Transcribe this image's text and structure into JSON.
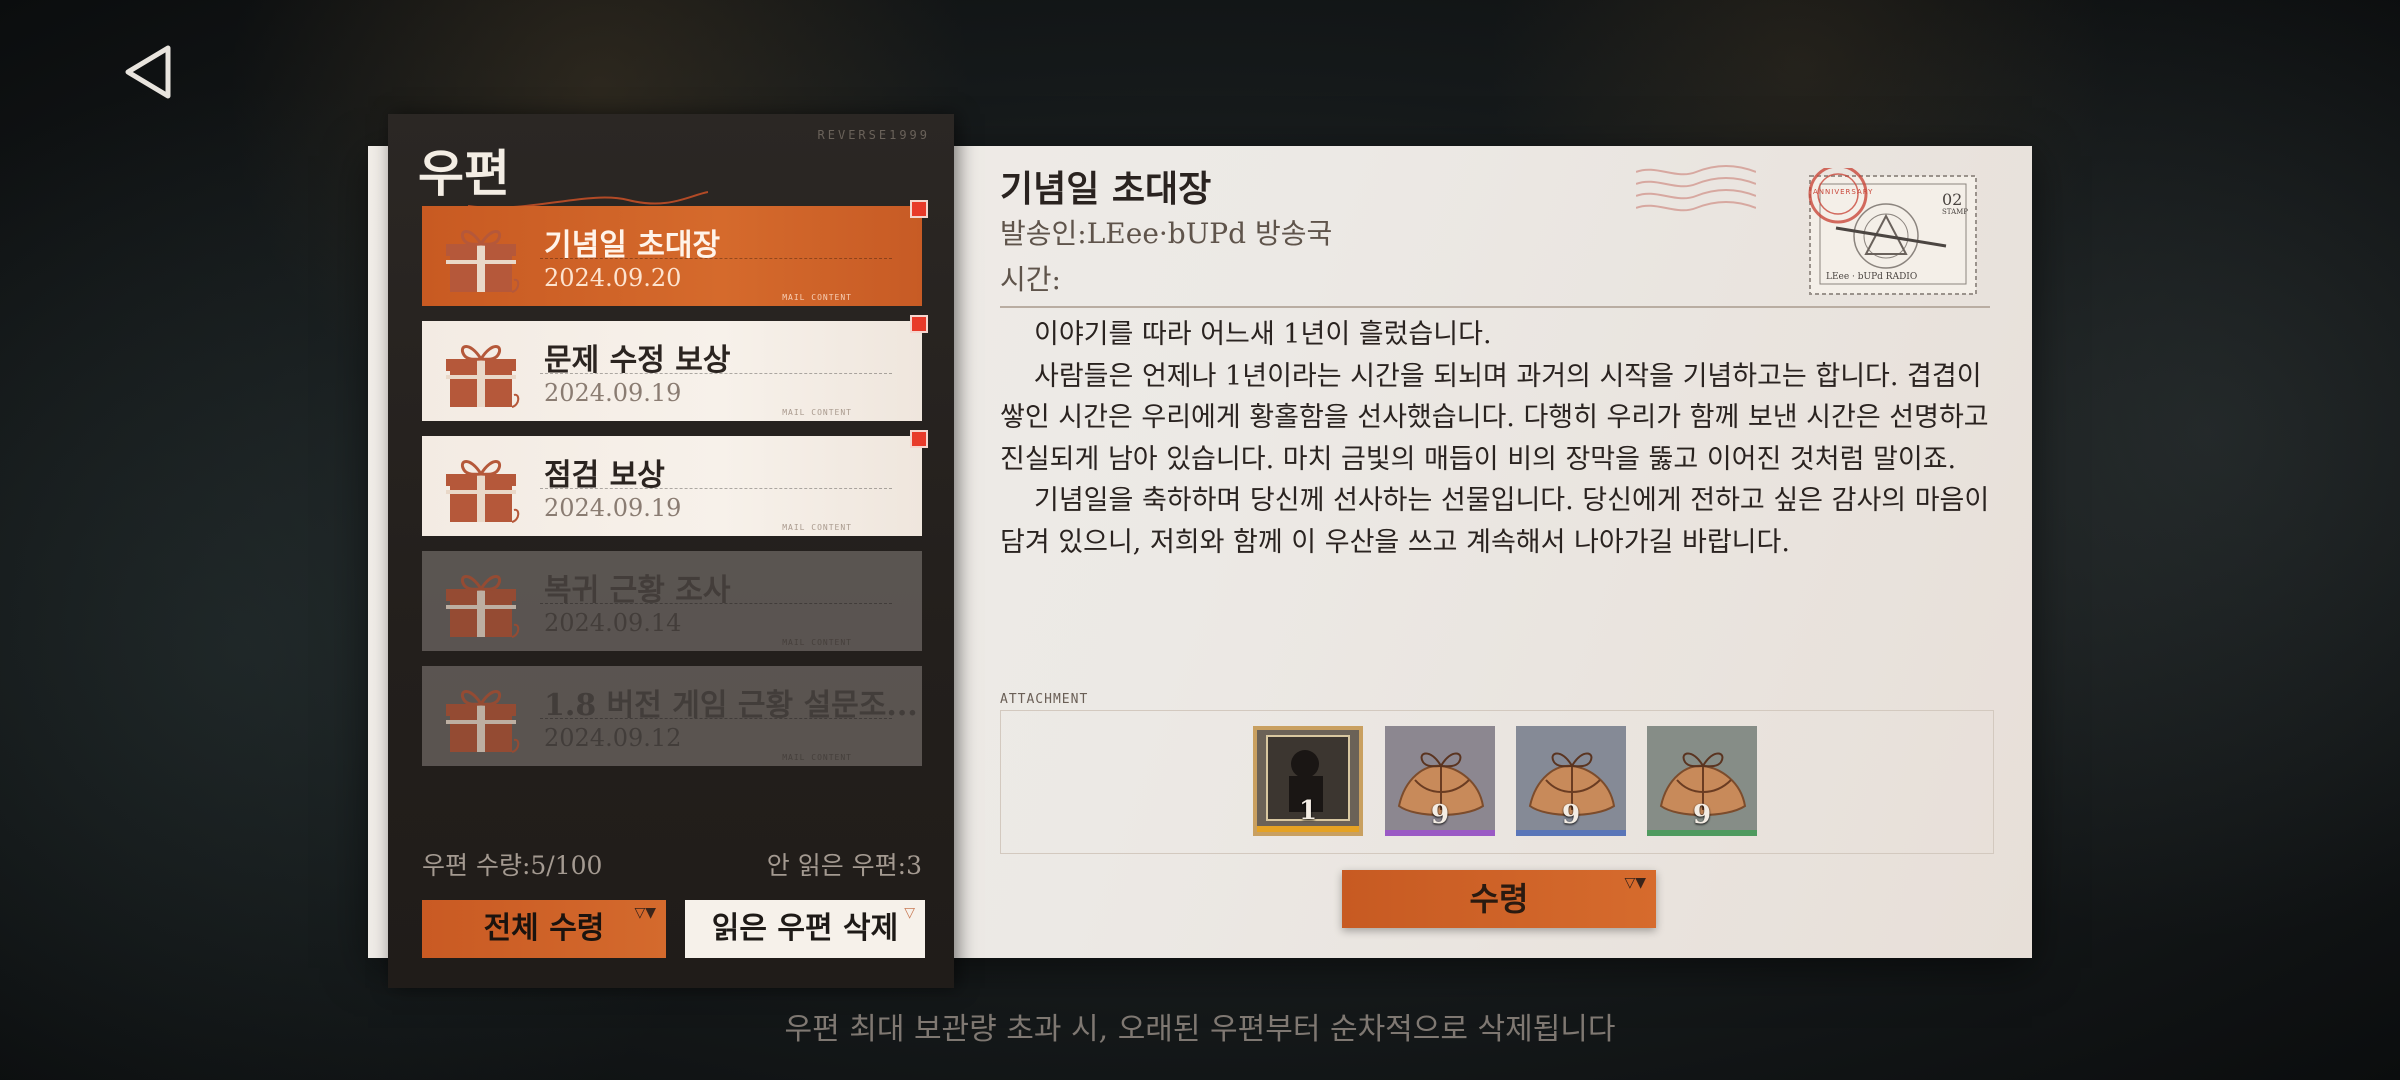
{
  "header": {
    "back_icon": "back-triangle-icon"
  },
  "panel": {
    "title": "우편",
    "brand": "REVERSE1999",
    "stats": {
      "count_label": "우편 수량:5/100",
      "unread_label": "안 읽은 우편:3"
    },
    "claim_all_label": "전체 수령",
    "delete_read_label": "읽은 우편 삭제"
  },
  "mails": [
    {
      "title": "기념일 초대장",
      "date": "2024.09.20",
      "state": "selected",
      "tag": "MAIL CONTENT",
      "new": true
    },
    {
      "title": "문제 수정 보상",
      "date": "2024.09.19",
      "state": "unread",
      "tag": "MAIL CONTENT",
      "new": true
    },
    {
      "title": "점검 보상",
      "date": "2024.09.19",
      "state": "unread",
      "tag": "MAIL CONTENT",
      "new": true
    },
    {
      "title": "복귀 근황 조사",
      "date": "2024.09.14",
      "state": "read",
      "tag": "MAIL CONTENT",
      "new": false
    },
    {
      "title": "1.8 버전 게임 근황 설문조...",
      "date": "2024.09.12",
      "state": "read",
      "tag": "MAIL CONTENT",
      "new": false
    }
  ],
  "detail": {
    "title": "기념일 초대장",
    "sender": "발송인:LEee·bUPd 방송국",
    "time": "시간:",
    "paragraphs": [
      "이야기를 따라 어느새 1년이 흘렀습니다.",
      "사람들은 언제나 1년이라는 시간을 되뇌며 과거의 시작을 기념하고는 합니다. 겹겹이 쌓인 시간은 우리에게 황홀함을 선사했습니다. 다행히 우리가 함께 보낸 시간은 선명하고 진실되게 남아 있습니다. 마치 금빛의 매듭이 비의 장막을 뚫고 이어진 것처럼 말이죠.",
      "기념일을 축하하며 당신께 선사하는 선물입니다. 당신에게 전하고 싶은 감사의 마음이 담겨 있으니, 저희와 함께 이 우산을 쓰고 계속해서 나아가길 바랍니다."
    ],
    "stamp": {
      "number": "02",
      "label": "STAMP",
      "footer": "LEee · bUPd RADIO",
      "postmark": "ANNIVERSARY"
    },
    "attachment_label": "ATTACHMENT",
    "attachments": [
      {
        "qty": "1",
        "rarity_color": "#e5a224",
        "icon": "portrait-card-icon"
      },
      {
        "qty": "9",
        "rarity_color": "#9a5ac4",
        "icon": "gift-bundle-icon"
      },
      {
        "qty": "9",
        "rarity_color": "#5a76b8",
        "icon": "gift-bundle-icon"
      },
      {
        "qty": "9",
        "rarity_color": "#4f9a5f",
        "icon": "gift-bundle-icon"
      }
    ],
    "claim_label": "수령"
  },
  "footer": {
    "note": "우편 최대 보관량 초과 시, 오래된 우편부터 순차적으로 삭제됩니다"
  },
  "colors": {
    "accent": "#d0642a",
    "new_badge": "#e83a2a"
  }
}
